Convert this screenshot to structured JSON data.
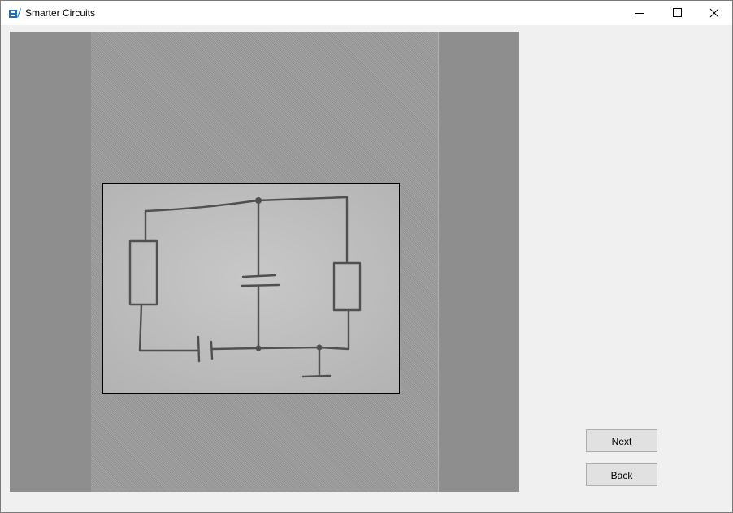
{
  "window": {
    "title": "Smarter Circuits",
    "icon": "app-icon"
  },
  "caption_buttons": {
    "minimize": "minimize-icon",
    "maximize": "maximize-icon",
    "close": "close-icon"
  },
  "preview": {
    "image_description_icon": "hand-drawn-circuit-photo"
  },
  "actions": {
    "next_label": "Next",
    "back_label": "Back"
  },
  "colors": {
    "titlebar": "#ffffff",
    "window_bg": "#f0f0f0",
    "preview_bg": "#8e8e8e",
    "button_bg": "#e1e1e1",
    "button_border": "#adadad",
    "app_icon": "#1f6fb2"
  }
}
